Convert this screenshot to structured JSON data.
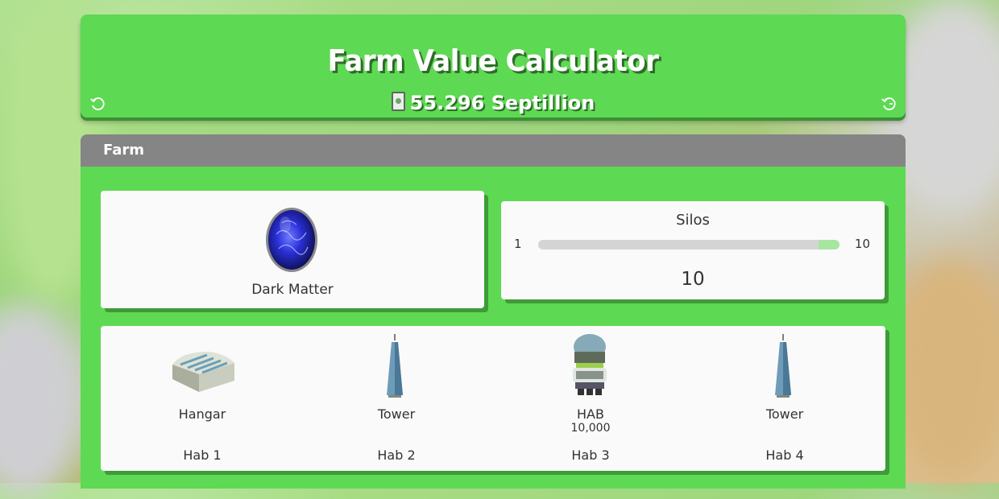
{
  "header": {
    "title": "Farm Value Calculator",
    "value": "55.296 Septillion",
    "cash_icon": "cash-icon",
    "reset_icon": "reset-icon"
  },
  "farm": {
    "section_title": "Farm",
    "egg": {
      "name": "Dark Matter",
      "icon": "dark-matter-egg-icon"
    },
    "silos": {
      "label": "Silos",
      "min": "1",
      "max": "10",
      "value": "10",
      "fill_fraction": 1.0
    },
    "habs": [
      {
        "name": "Hangar",
        "capacity": "",
        "slot": "Hab 1",
        "icon": "hangar-icon"
      },
      {
        "name": "Tower",
        "capacity": "",
        "slot": "Hab 2",
        "icon": "tower-icon"
      },
      {
        "name": "HAB",
        "capacity": "10,000",
        "slot": "Hab 3",
        "icon": "hab-10000-icon"
      },
      {
        "name": "Tower",
        "capacity": "",
        "slot": "Hab 4",
        "icon": "tower-icon"
      }
    ]
  },
  "colors": {
    "panel_green": "#5ed953",
    "header_gray": "#858585",
    "card": "#fafafa"
  }
}
